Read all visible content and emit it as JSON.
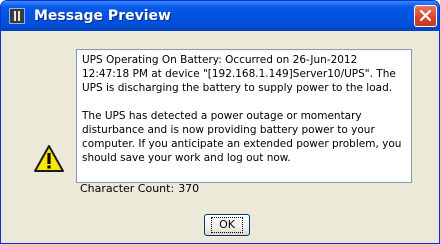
{
  "window": {
    "title": "Message Preview"
  },
  "message": {
    "paragraph1": "UPS Operating On Battery: Occurred on 26-Jun-2012 12:47:18 PM at device \"[192.168.1.149]Server10/UPS\". The UPS is discharging the battery to supply power to the load.",
    "paragraph2": "The UPS has detected a power outage or momentary disturbance and is now providing battery power to your computer.  If you anticipate an extended power problem, you should save your work and log out now."
  },
  "character_count": {
    "label": "Character Count:",
    "value": "370"
  },
  "buttons": {
    "ok_label": "OK"
  },
  "icons": {
    "title": "app-icon",
    "close": "close-icon",
    "message": "warning-icon"
  },
  "colors": {
    "titlebar": "#0054e3",
    "close_button": "#d9452b",
    "dialog_bg": "#ece9d8",
    "warning_yellow": "#ffe600"
  }
}
